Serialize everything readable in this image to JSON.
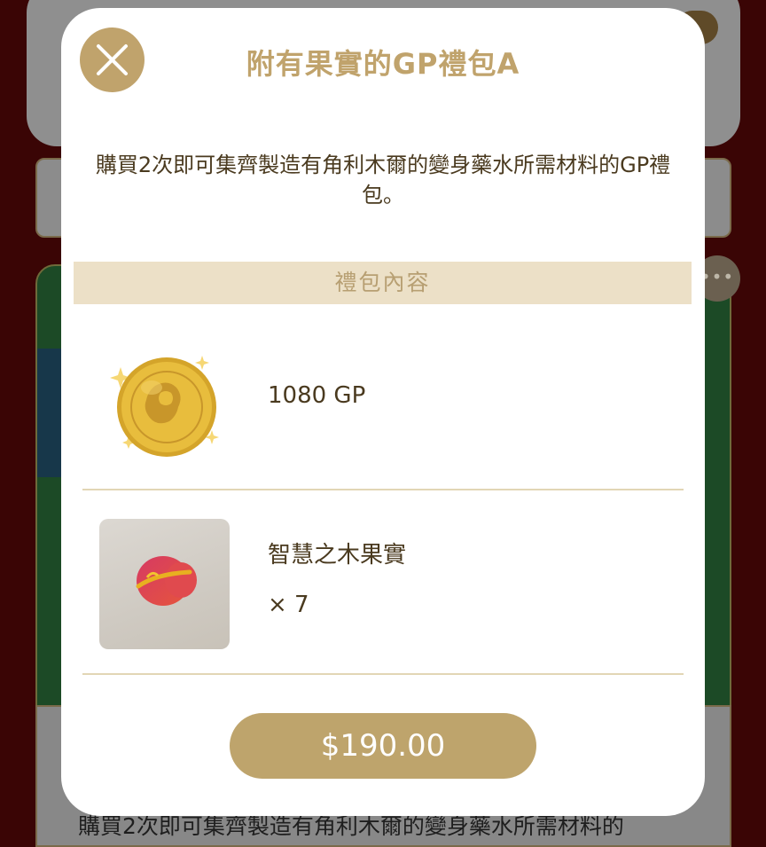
{
  "modal": {
    "title": "附有果實的GP禮包A",
    "description": "購買2次即可集齊製造有角利木爾的變身藥水所需材料的GP禮包。",
    "section_title": "禮包內容",
    "items": [
      {
        "name": "1080 GP",
        "icon": "gp-coin-icon"
      },
      {
        "name": "智慧之木果實",
        "quantity": "× 7",
        "icon": "fruit-icon"
      }
    ],
    "price": "$190.00",
    "close_icon": "close-icon"
  },
  "background": {
    "more_icon": "more-dots-icon",
    "lower_text": "購買2次即可集齊製造有角利木爾的變身藥水所需材料的"
  },
  "colors": {
    "accent": "#c0a36c",
    "section_bg": "#ece0c7",
    "text": "#4a3a1f",
    "backdrop": "#3a0505"
  }
}
